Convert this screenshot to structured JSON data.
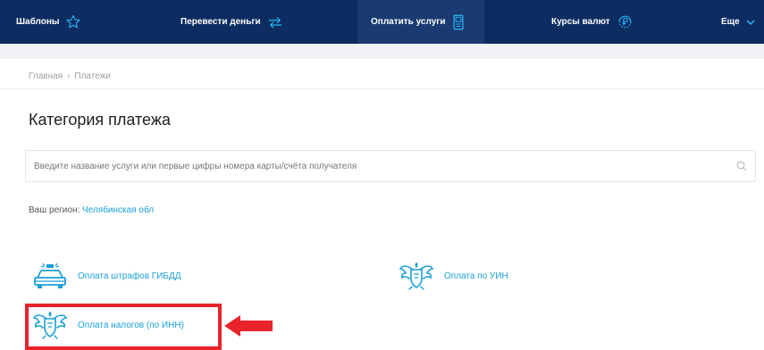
{
  "nav": {
    "items": [
      {
        "label": "Шаблоны",
        "icon": "star-icon"
      },
      {
        "label": "Перевести деньги",
        "icon": "transfer-arrows-icon"
      },
      {
        "label": "Оплатить услуги",
        "icon": "payment-terminal-icon",
        "active": true
      },
      {
        "label": "Курсы валют",
        "icon": "currency-ruble-icon"
      },
      {
        "label": "Еще",
        "icon": "chevron-down-icon"
      }
    ]
  },
  "breadcrumb": {
    "home": "Главная",
    "separator": "›",
    "current": "Платежи"
  },
  "page_title": "Категория платежа",
  "search": {
    "placeholder": "Введите название услуги или первые цифры номера карты/счёта получателя",
    "value": ""
  },
  "region": {
    "label": "Ваш регион:",
    "value": "Челябинская обл"
  },
  "categories": [
    {
      "label": "Оплата штрафов ГИБДД",
      "icon": "police-car-icon"
    },
    {
      "label": "Оплата по УИН",
      "icon": "coat-of-arms-icon"
    },
    {
      "label": "Оплата налогов (по ИНН)",
      "icon": "coat-of-arms-icon",
      "highlighted": true
    }
  ],
  "colors": {
    "nav_background": "#0d2c61",
    "accent": "#1a9fd8",
    "highlight": "#e8232a"
  }
}
